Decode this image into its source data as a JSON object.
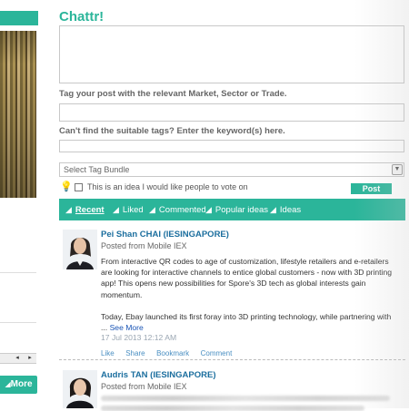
{
  "left_panel": {
    "more_button": "More",
    "scroll_left": "◂",
    "scroll_right": "▸"
  },
  "chattr": {
    "title": "Chattr!",
    "tag_label": "Tag your post with the relevant Market, Sector or Trade.",
    "keyword_label": "Can't find the suitable tags? Enter the keyword(s) here.",
    "tag_bundle_select": "Select Tag Bundle",
    "vote_checkbox_label": "This is an idea I would like people to vote on",
    "post_button": "Post"
  },
  "tabs": [
    {
      "label": "Recent",
      "active": true
    },
    {
      "label": "Liked",
      "active": false
    },
    {
      "label": "Commented",
      "active": false
    },
    {
      "label": "Popular ideas",
      "active": false
    },
    {
      "label": "Ideas",
      "active": false
    }
  ],
  "posts": [
    {
      "author": "Pei Shan CHAI (IESINGAPORE)",
      "source": "Posted from Mobile IEX",
      "body_lines": [
        "From interactive QR codes to age of customization, lifestyle retailers and e-retailers",
        "are looking for interactive channels to entice global customers - now with 3D printing",
        "app! This opens new possibilities for Spore's 3D tech as global interests gain",
        "momentum.",
        "",
        "Today, Ebay launched its first foray into 3D printing technology, while partnering with"
      ],
      "ellipsis": "... ",
      "see_more": "See More",
      "date": "17 Jul 2013 12:12 AM",
      "actions": [
        "Like",
        "Share",
        "Bookmark",
        "Comment"
      ]
    },
    {
      "author": "Audris TAN (IESINGAPORE)",
      "source": "Posted from Mobile IEX"
    }
  ],
  "icons": {
    "bulb": "lightbulb-icon",
    "tab": "triangle-pointer-icon",
    "dropdown": "chevron-down-icon"
  },
  "colors": {
    "accent": "#2bb59a",
    "link": "#1b6e9e",
    "see_more": "#1a55b5"
  }
}
